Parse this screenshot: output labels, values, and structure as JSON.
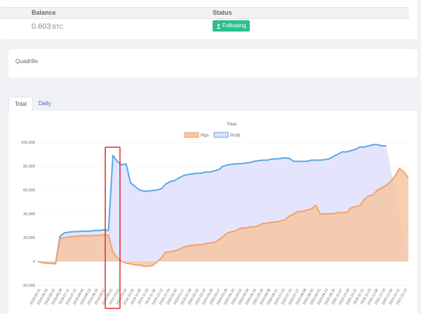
{
  "balance_table": {
    "headers": {
      "balance": "Balance",
      "status": "Status"
    },
    "balance_value": "0.603",
    "balance_unit": "BTC",
    "status_label": "Following"
  },
  "strategy": {
    "name": "Quadrille"
  },
  "tabs": [
    {
      "label": "Total",
      "active": true
    },
    {
      "label": "Daily",
      "active": false
    }
  ],
  "chart_data": {
    "type": "area",
    "title": "Total",
    "legend_position": "top",
    "ylim": [
      -20000,
      100000
    ],
    "y_ticks": [
      "100,000",
      "80,000",
      "60,000",
      "40,000",
      "20,000",
      "0",
      "-20,000"
    ],
    "x_ticks": [
      "2019-05-21",
      "2019-06-03",
      "2019-06-15",
      "2019-06-29",
      "2019-07-11",
      "2019-07-23",
      "2019-08-04",
      "2019-08-14",
      "2019-08-26",
      "2019-09-07",
      "2019-09-21",
      "2019-10-01",
      "2019-10-13",
      "2019-10-25",
      "2019-11-06",
      "2019-11-18",
      "2019-11-30",
      "2019-12-12",
      "2019-12-24",
      "2020-01-05",
      "2020-01-17",
      "2020-01-29",
      "2020-02-10",
      "2020-02-22",
      "2020-03-05",
      "2020-03-17",
      "2020-03-29",
      "2020-04-10",
      "2020-04-22",
      "2020-05-04",
      "2020-05-16",
      "2020-05-28",
      "2020-06-09",
      "2020-06-21",
      "2020-07-03",
      "2020-07-15",
      "2020-07-27",
      "2020-08-08",
      "2020-08-20",
      "2020-09-01",
      "2020-09-13",
      "2020-09-25",
      "2020-10-07",
      "2020-10-19",
      "2020-10-31",
      "2020-11-12",
      "2020-11-24",
      "2020-12-06",
      "2020-12-18",
      "2020-12-30",
      "2021-01-11",
      "2021-01-23"
    ],
    "series": [
      {
        "name": "Pips",
        "color": "#f0a36b",
        "fill": "#f4c7a3",
        "values": [
          0,
          -1000,
          -1500,
          -1500,
          -2000,
          19000,
          20000,
          20500,
          21000,
          21000,
          21500,
          21500,
          21500,
          22000,
          22000,
          22500,
          22000,
          8000,
          3000,
          0,
          -1500,
          -2000,
          -3000,
          -3000,
          -4000,
          -4000,
          -3500,
          -500,
          3000,
          8000,
          8000,
          9000,
          10000,
          12000,
          13000,
          13500,
          14000,
          14000,
          15000,
          15500,
          16000,
          18000,
          21000,
          24000,
          25000,
          26000,
          28000,
          28000,
          29000,
          29000,
          30000,
          32000,
          32000,
          33000,
          33000,
          34000,
          35000,
          38000,
          40000,
          42000,
          42000,
          43000,
          44000,
          47000,
          40000,
          40000,
          40000,
          40000,
          41000,
          41000,
          41000,
          45000,
          46000,
          47000,
          52000,
          55000,
          56000,
          60000,
          62000,
          64000,
          67000,
          72000,
          78000,
          75000,
          70000
        ]
      },
      {
        "name": "Profit",
        "color": "#5ba8e5",
        "fill": "#dfe0fb",
        "values": [
          0,
          -1000,
          -1500,
          -1500,
          -2000,
          21000,
          24000,
          24500,
          25000,
          25000,
          25500,
          25500,
          25500,
          26000,
          26000,
          26500,
          26000,
          89000,
          84000,
          81000,
          82000,
          66000,
          63000,
          60000,
          59000,
          59000,
          59500,
          60000,
          61000,
          65000,
          67000,
          68000,
          70000,
          72000,
          73000,
          73500,
          74000,
          74000,
          75000,
          75000,
          76000,
          77000,
          80000,
          81000,
          81500,
          82000,
          82000,
          82500,
          83000,
          84000,
          84500,
          85000,
          85000,
          86000,
          86000,
          86500,
          87000,
          86500,
          84000,
          84000,
          84000,
          84000,
          85000,
          85000,
          85000,
          85500,
          86000,
          88000,
          90000,
          92000,
          92000,
          93000,
          94000,
          96000,
          96000,
          97000,
          98000,
          98000,
          97000,
          97000
        ]
      }
    ]
  }
}
